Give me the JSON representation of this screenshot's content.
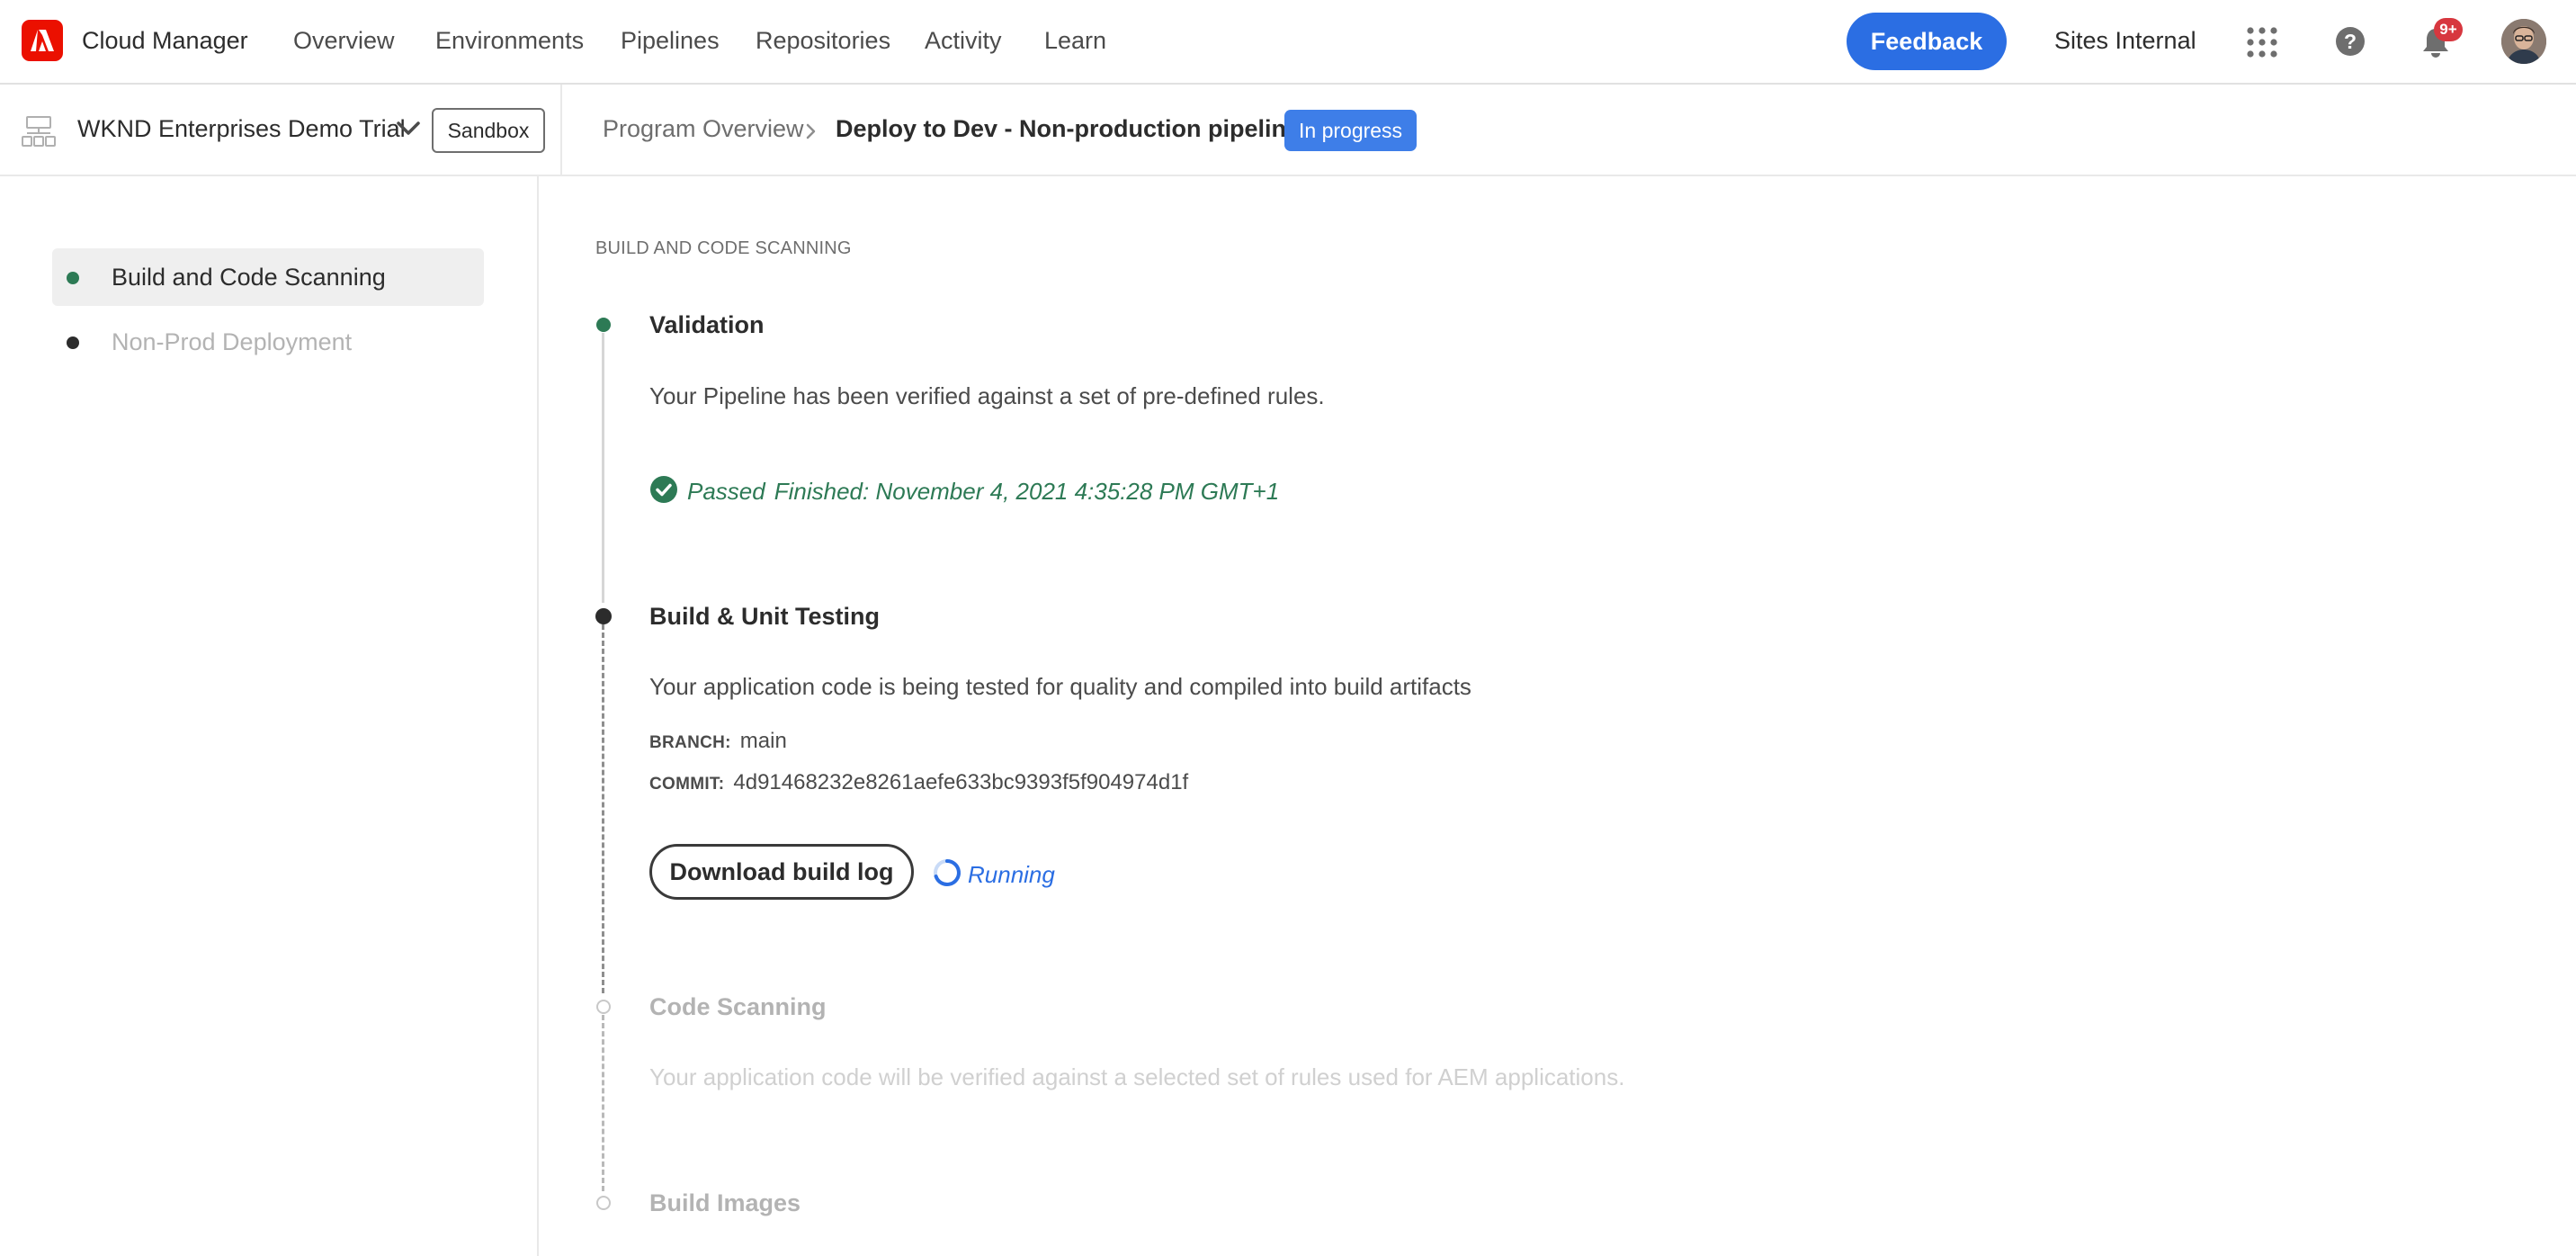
{
  "topbar": {
    "app_title": "Cloud Manager",
    "nav": [
      "Overview",
      "Environments",
      "Pipelines",
      "Repositories",
      "Activity",
      "Learn"
    ],
    "feedback_label": "Feedback",
    "org_name": "Sites Internal",
    "notification_count": "9+",
    "icons": [
      "adobe-logo-icon",
      "apps-grid-icon",
      "help-icon",
      "bell-icon",
      "avatar"
    ]
  },
  "subheader": {
    "program_name": "WKND Enterprises Demo Trial",
    "program_tag": "Sandbox",
    "breadcrumb_parent": "Program Overview",
    "breadcrumb_current": "Deploy to Dev - Non-production pipeline",
    "status": "In progress"
  },
  "sidebar": {
    "items": [
      {
        "label": "Build and Code Scanning",
        "active": true,
        "dot_color": "#2d7a55"
      },
      {
        "label": "Non-Prod Deployment",
        "active": false,
        "dot_color": "#2c2c2c"
      }
    ]
  },
  "main": {
    "section_heading": "BUILD AND CODE SCANNING",
    "steps": [
      {
        "title": "Validation",
        "description": "Your Pipeline has been verified against a set of pre-defined rules.",
        "status": "Passed",
        "finished": "Finished: November 4, 2021 4:35:28 PM GMT+1"
      },
      {
        "title": "Build & Unit Testing",
        "description": "Your application code is being tested for quality and compiled into build artifacts",
        "branch_label": "BRANCH:",
        "branch": "main",
        "commit_label": "COMMIT:",
        "commit": "4d91468232e8261aefe633bc9393f5f904974d1f",
        "download_label": "Download build log",
        "status": "Running"
      },
      {
        "title": "Code Scanning",
        "description": "Your application code will be verified against a selected set of rules used for AEM applications."
      },
      {
        "title": "Build Images"
      }
    ]
  },
  "colors": {
    "accent": "#2b6ee3",
    "badge_blue": "#3e7ee8",
    "success": "#2d7a55",
    "adobe_red": "#eb1000",
    "disabled_text": "#c8c8c8"
  }
}
